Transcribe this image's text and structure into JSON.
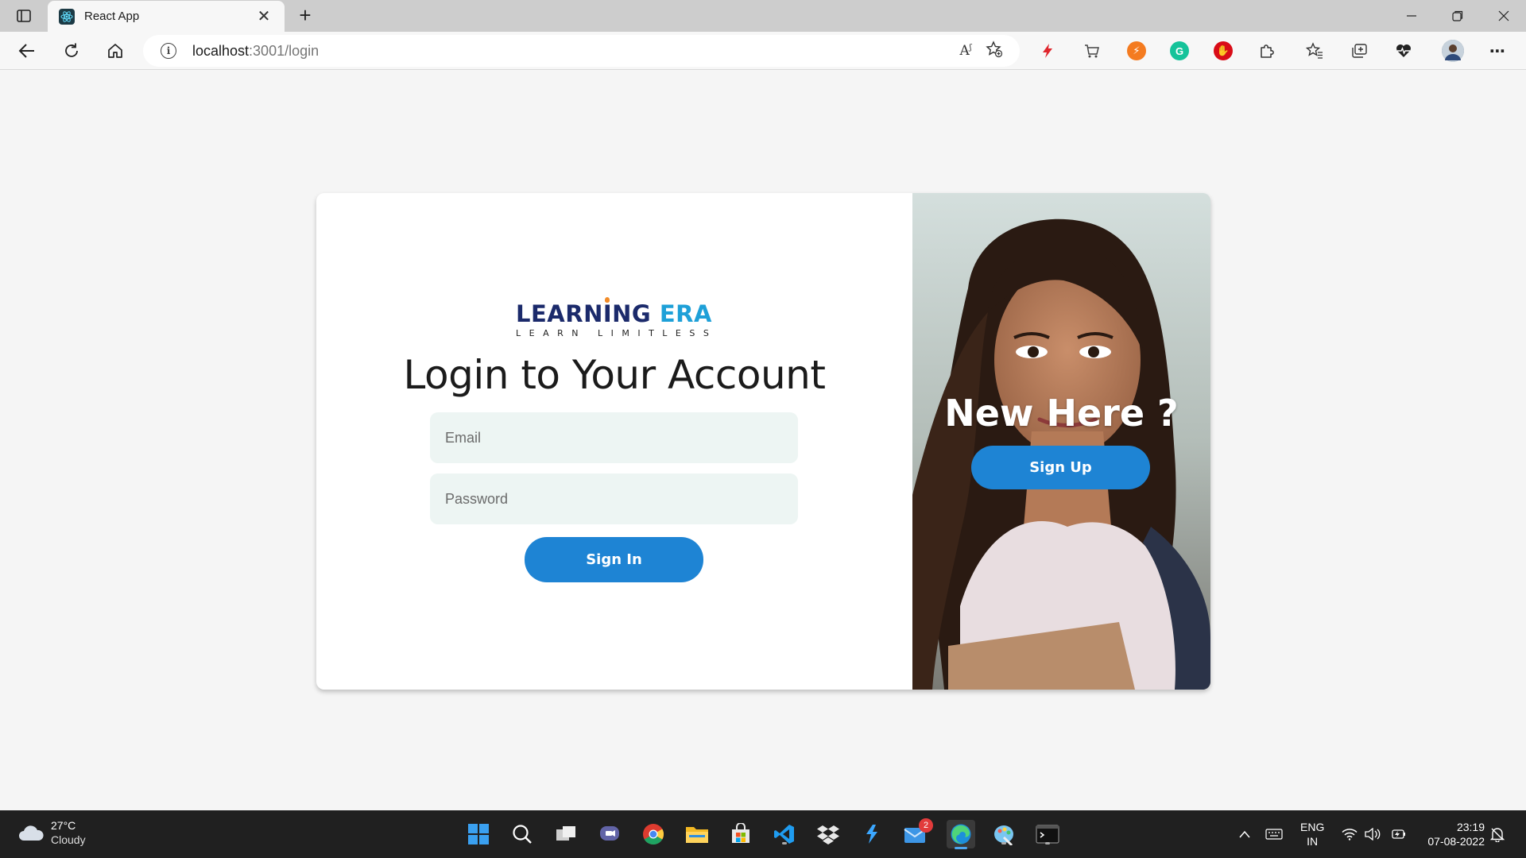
{
  "browser": {
    "tab_title": "React App",
    "url_host": "localhost",
    "url_path": ":3001/login",
    "window_controls": [
      "minimize",
      "restore",
      "close"
    ]
  },
  "page": {
    "logo": {
      "brand_part1": "LEARNING",
      "brand_part2": "ERA",
      "tagline": "LEARN LIMITLESS"
    },
    "heading": "Login to Your Account",
    "email_placeholder": "Email",
    "password_placeholder": "Password",
    "signin_label": "Sign In",
    "side_heading": "New Here ?",
    "signup_label": "Sign Up"
  },
  "taskbar": {
    "weather_temp": "27°C",
    "weather_condition": "Cloudy",
    "mail_badge": "2",
    "lang_line1": "ENG",
    "lang_line2": "IN",
    "time": "23:19",
    "date": "07-08-2022"
  },
  "colors": {
    "primary_button": "#1e84d4",
    "input_bg": "#edf5f3",
    "page_bg": "#f5f5f5",
    "brand_dark": "#1b2a6b",
    "brand_light": "#1ea0d8"
  }
}
